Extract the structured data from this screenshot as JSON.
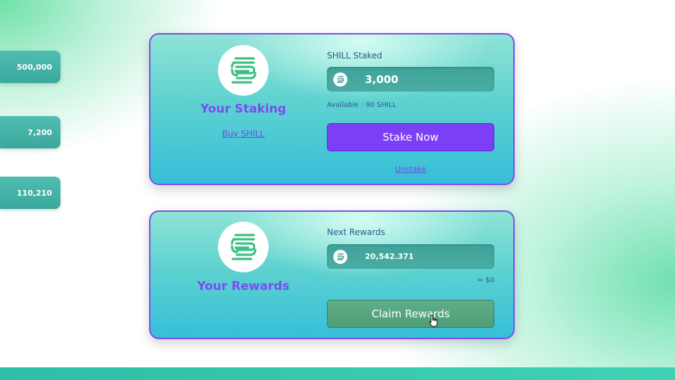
{
  "side_stats": [
    "500,000",
    "7,200",
    "110,210"
  ],
  "staking": {
    "title": "Your Staking",
    "buy_link": "Buy SHILL",
    "field_label": "SHILL Staked",
    "amount": "3,000",
    "available": "Available : 90 SHILL",
    "stake_button": "Stake Now",
    "unstake_link": "Unstake"
  },
  "rewards": {
    "title": "Your Rewards",
    "field_label": "Next Rewards",
    "amount": "20,542.371",
    "usd_value": "≈ $0",
    "claim_button": "Claim Rewards"
  },
  "icons": {
    "logo": "shill-logo-icon",
    "coin": "shill-coin-icon",
    "cursor": "hand-pointer-icon"
  },
  "colors": {
    "accent": "#7b3ff5",
    "claim": "#5fae86",
    "logo_green": "#3cc083"
  }
}
